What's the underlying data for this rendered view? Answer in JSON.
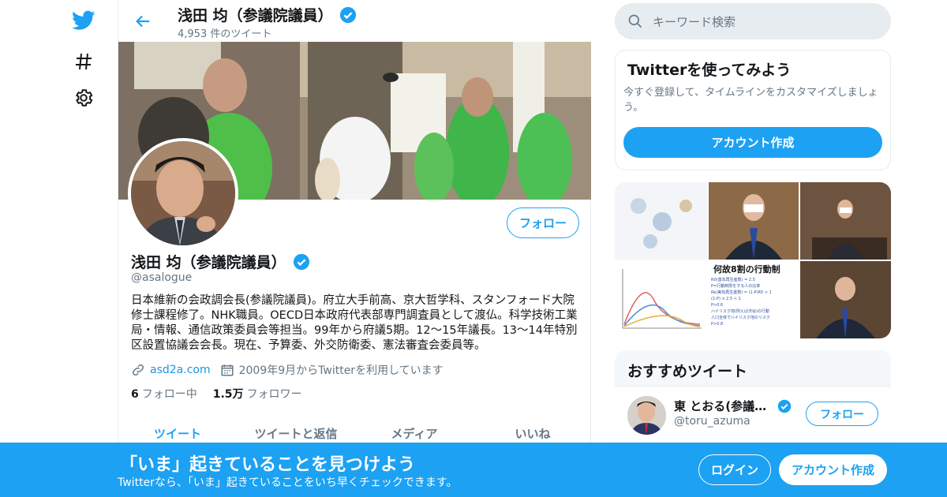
{
  "colors": {
    "accent": "#1da1f2",
    "muted": "#657786",
    "border": "#e6ecf0"
  },
  "nav": {
    "items": [
      {
        "icon": "twitter-bird-icon"
      },
      {
        "icon": "hashtag-icon"
      },
      {
        "icon": "gear-icon"
      }
    ]
  },
  "header": {
    "name": "浅田 均（参議院議員）",
    "tweet_count": "4,953 件のツイート"
  },
  "profile": {
    "follow_label": "フォロー",
    "name": "浅田 均（参議院議員）",
    "handle": "@asalogue",
    "bio": "日本維新の会政調会長(参議院議員)。府立大手前高、京大哲学科、スタンフォード大院修士課程修了。NHK職員。OECD日本政府代表部専門調査員として渡仏。科学技術工業局・情報、通信政策委員会等担当。99年から府議5期。12～15年議長。13～14年特別区設置協議会会長。現在、予算委、外交防衛委、憲法審査会委員等。",
    "link": "asd2a.com",
    "joined": "2009年9月からTwitterを利用しています",
    "following_count": "6",
    "following_label": "フォロー中",
    "followers_count": "1.5万",
    "followers_label": "フォロワー"
  },
  "tabs": [
    {
      "label": "ツイート",
      "active": true
    },
    {
      "label": "ツイートと返信",
      "active": false
    },
    {
      "label": "メディア",
      "active": false
    },
    {
      "label": "いいね",
      "active": false
    }
  ],
  "search": {
    "placeholder": "キーワード検索"
  },
  "signup_card": {
    "title": "Twitterを使ってみよう",
    "text": "今すぐ登録して、タイムラインをカスタマイズしましょう。",
    "button": "アカウント作成"
  },
  "media_grid": {
    "text": "何故8割の行動制",
    "lines": [
      "R0(基本再生産数) = 2.5",
      "P=行動制限をする人の比率",
      "Re(実効再生産数) = (1-P)R0 < 1",
      "(1-P) × 2.5 < 1",
      "P>0.6",
      "ハイリスク地(例えば渋谷)の行動",
      "人口全体でハイリスク地のリスク",
      "P>0.8"
    ]
  },
  "recommend": {
    "title": "おすすめツイート",
    "items": [
      {
        "name": "東 とおる(参議…",
        "handle": "@toru_azuma",
        "button": "フォロー"
      }
    ]
  },
  "bottom_bar": {
    "title": "「いま」起きていることを見つけよう",
    "subtitle": "Twitterなら、「いま」起きていることをいち早くチェックできます。",
    "login": "ログイン",
    "signup": "アカウント作成"
  }
}
